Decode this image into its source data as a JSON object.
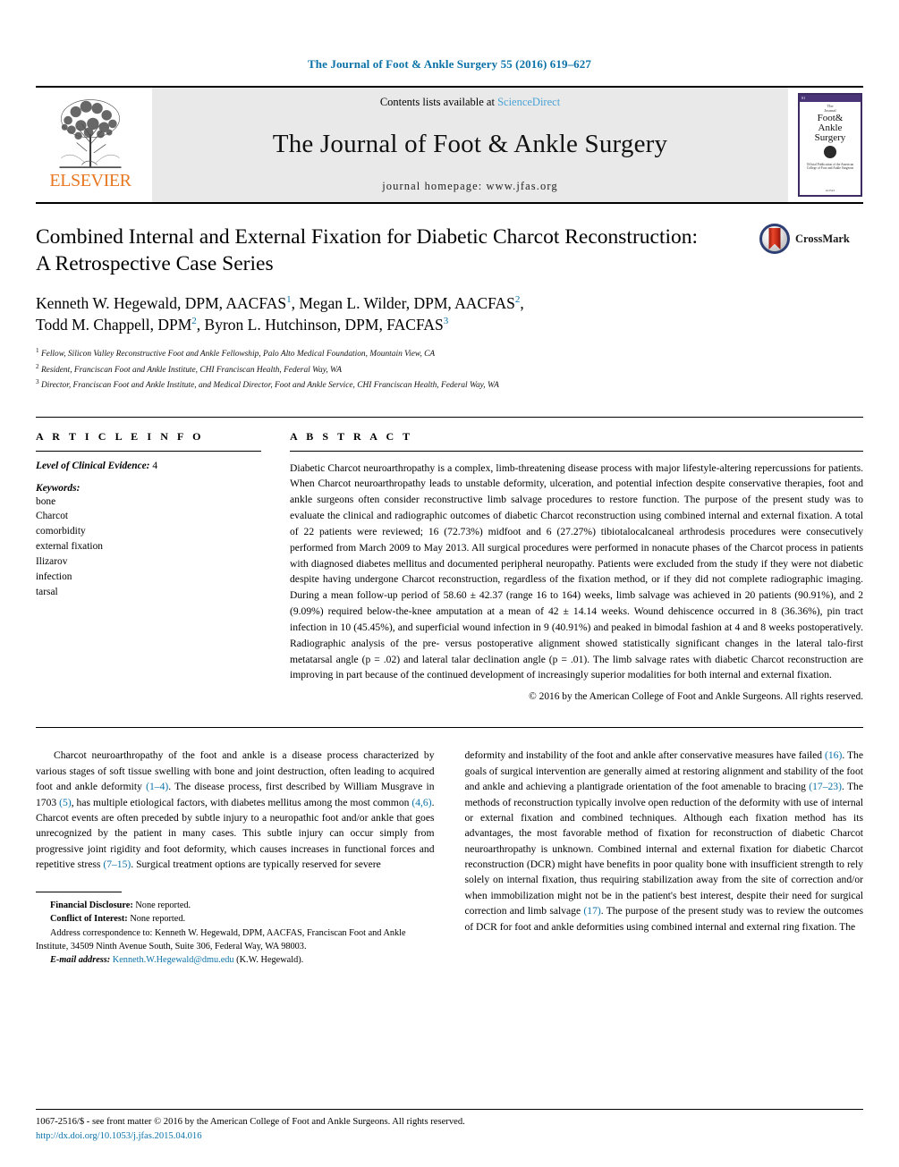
{
  "running_head": "The Journal of Foot & Ankle Surgery 55 (2016) 619–627",
  "masthead": {
    "publisher_name": "ELSEVIER",
    "contents_prefix": "Contents lists available at ",
    "contents_link": "ScienceDirect",
    "journal_name": "The Journal of Foot & Ankle Surgery",
    "homepage": "journal homepage: www.jfas.org",
    "cover": {
      "topbar": "S1",
      "pretitle_line1": "The",
      "pretitle_line2": "Journal",
      "title_line1": "Foot&",
      "title_line2": "Ankle",
      "title_line3": "Surgery",
      "of_word": "of",
      "footer": "Official Publication of the American College of Foot and Ankle Surgeons",
      "bottombar": "ACFAS"
    }
  },
  "article": {
    "title": "Combined Internal and External Fixation for Diabetic Charcot Reconstruction: A Retrospective Case Series",
    "authors_line1_a": "Kenneth W. Hegewald, DPM, AACFAS",
    "authors_line1_sup1": "1",
    "authors_line1_b": ", Megan L. Wilder, DPM, AACFAS",
    "authors_line1_sup2": "2",
    "authors_line1_c": ",",
    "authors_line2_a": "Todd M. Chappell, DPM",
    "authors_line2_sup1": "2",
    "authors_line2_b": ", Byron L. Hutchinson, DPM, FACFAS",
    "authors_line2_sup2": "3",
    "affiliations": [
      {
        "num": "1",
        "text": "Fellow, Silicon Valley Reconstructive Foot and Ankle Fellowship, Palo Alto Medical Foundation, Mountain View, CA"
      },
      {
        "num": "2",
        "text": "Resident, Franciscan Foot and Ankle Institute, CHI Franciscan Health, Federal Way, WA"
      },
      {
        "num": "3",
        "text": "Director, Franciscan Foot and Ankle Institute, and Medical Director, Foot and Ankle Service, CHI Franciscan Health, Federal Way, WA"
      }
    ],
    "crossmark_label": "CrossMark"
  },
  "article_info": {
    "heading": "A R T I C L E   I N F O",
    "level_label": "Level of Clinical Evidence:",
    "level_value": "4",
    "keywords_label": "Keywords:",
    "keywords": [
      "bone",
      "Charcot",
      "comorbidity",
      "external fixation",
      "Ilizarov",
      "infection",
      "tarsal"
    ]
  },
  "abstract": {
    "heading": "A B S T R A C T",
    "text": "Diabetic Charcot neuroarthropathy is a complex, limb-threatening disease process with major lifestyle-altering repercussions for patients. When Charcot neuroarthropathy leads to unstable deformity, ulceration, and potential infection despite conservative therapies, foot and ankle surgeons often consider reconstructive limb salvage procedures to restore function. The purpose of the present study was to evaluate the clinical and radiographic outcomes of diabetic Charcot reconstruction using combined internal and external fixation. A total of 22 patients were reviewed; 16 (72.73%) midfoot and 6 (27.27%) tibiotalocalcaneal arthrodesis procedures were consecutively performed from March 2009 to May 2013. All surgical procedures were performed in nonacute phases of the Charcot process in patients with diagnosed diabetes mellitus and documented peripheral neuropathy. Patients were excluded from the study if they were not diabetic despite having undergone Charcot reconstruction, regardless of the fixation method, or if they did not complete radiographic imaging. During a mean follow-up period of 58.60 ± 42.37 (range 16 to 164) weeks, limb salvage was achieved in 20 patients (90.91%), and 2 (9.09%) required below-the-knee amputation at a mean of 42 ± 14.14 weeks. Wound dehiscence occurred in 8 (36.36%), pin tract infection in 10 (45.45%), and superficial wound infection in 9 (40.91%) and peaked in bimodal fashion at 4 and 8 weeks postoperatively. Radiographic analysis of the pre- versus postoperative alignment showed statistically significant changes in the lateral talo-first metatarsal angle (p = .02) and lateral talar declination angle (p = .01). The limb salvage rates with diabetic Charcot reconstruction are improving in part because of the continued development of increasingly superior modalities for both internal and external fixation.",
    "copyright": "© 2016 by the American College of Foot and Ankle Surgeons. All rights reserved."
  },
  "body": {
    "left_column": {
      "part1": "Charcot neuroarthropathy of the foot and ankle is a disease process characterized by various stages of soft tissue swelling with bone and joint destruction, often leading to acquired foot and ankle deformity ",
      "ref1": "(1–4)",
      "part2": ". The disease process, first described by William Musgrave in 1703 ",
      "ref2": "(5)",
      "part3": ", has multiple etiological factors, with diabetes mellitus among the most common ",
      "ref3": "(4,6)",
      "part4": ". Charcot events are often preceded by subtle injury to a neuropathic foot and/or ankle that goes unrecognized by the patient in many cases. This subtle injury can occur simply from progressive joint rigidity and foot deformity, which causes increases in functional forces and repetitive stress ",
      "ref4": "(7–15)",
      "part5": ". Surgical treatment options are typically reserved for severe"
    },
    "right_column": {
      "part1": "deformity and instability of the foot and ankle after conservative measures have failed ",
      "ref1": "(16)",
      "part2": ". The goals of surgical intervention are generally aimed at restoring alignment and stability of the foot and ankle and achieving a plantigrade orientation of the foot amenable to bracing ",
      "ref2": "(17–23)",
      "part3": ". The methods of reconstruction typically involve open reduction of the deformity with use of internal or external fixation and combined techniques. Although each fixation method has its advantages, the most favorable method of fixation for reconstruction of diabetic Charcot neuroarthropathy is unknown. Combined internal and external fixation for diabetic Charcot reconstruction (DCR) might have benefits in poor quality bone with insufficient strength to rely solely on internal fixation, thus requiring stabilization away from the site of correction and/or when immobilization might not be in the patient's best interest, despite their need for surgical correction and limb salvage ",
      "ref3": "(17)",
      "part4": ". The purpose of the present study was to review the outcomes of DCR for foot and ankle deformities using combined internal and external ring fixation. The"
    }
  },
  "footnotes": {
    "financial_label": "Financial Disclosure:",
    "financial_value": " None reported.",
    "conflict_label": "Conflict of Interest:",
    "conflict_value": " None reported.",
    "address_text": "Address correspondence to: Kenneth W. Hegewald, DPM, AACFAS, Franciscan Foot and Ankle Institute, 34509 Ninth Avenue South, Suite 306, Federal Way, WA 98003.",
    "email_label": "E-mail address:",
    "email_value": "Kenneth.W.Hegewald@dmu.edu",
    "email_suffix": " (K.W. Hegewald)."
  },
  "footer": {
    "issn_line": "1067-2516/$ - see front matter © 2016 by the American College of Foot and Ankle Surgeons. All rights reserved.",
    "doi": "http://dx.doi.org/10.1053/j.jfas.2015.04.016"
  },
  "colors": {
    "link": "#0b72a8",
    "elsevier_orange": "#e87722",
    "sciencedirect": "#4aa3d6"
  }
}
